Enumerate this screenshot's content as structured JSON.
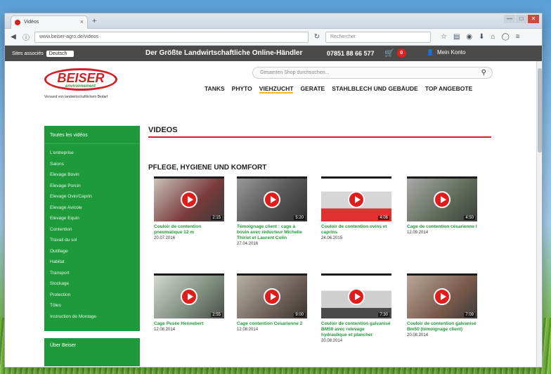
{
  "browser": {
    "tab_title": "Vidéos",
    "url": "www.beiser-agro.de/videos",
    "search_placeholder": "Rechercher",
    "window_controls": [
      "—",
      "□",
      "✕"
    ]
  },
  "topbar": {
    "lang_label": "Sites associés",
    "lang_value": "Deutsch",
    "tagline": "Der Größte Landwirtschaftliche Online-Händler",
    "phone": "07851 88 66 577",
    "cart_count": "0",
    "account_label": "Mein Konto"
  },
  "header": {
    "logo_main": "BEISER",
    "logo_sub": "environnement",
    "logo_tagline": "Versand von landwirtschaftlichem Bedarf",
    "search_placeholder": "Gesamten Shop durchsuchen...",
    "nav": [
      "TANKS",
      "PHYTO",
      "VIEHZUCHT",
      "GERATE",
      "STAHLBLECH UND GEBÄUDE",
      "TOP ANGEBOTE"
    ],
    "nav_active": "VIEHZUCHT"
  },
  "sidebar": {
    "head": "Toutes les vidéos",
    "items": [
      "L'entreprise",
      "Salons",
      "Elevage Bovin",
      "Elevage Porcin",
      "Elevage Ovin/Caprin",
      "Elevage Avicole",
      "Elevage Equin",
      "Contention",
      "Travail du sol",
      "Outillage",
      "Habitat",
      "Transport",
      "Stockage",
      "Protection",
      "Tôles",
      "Instruction de Montage"
    ],
    "footer": "Über Beiser"
  },
  "main": {
    "title": "VIDEOS",
    "section": "PFLEGE, HYGIENE UND KOMFORT",
    "videos": [
      {
        "title": "Couloir de contention pneumatique 12 m",
        "date": "20.07.2016",
        "duration": "2:15"
      },
      {
        "title": "Témoignage client : cage à bovin avec réducteur Michelle Thiriet et Laurent Colin",
        "date": "27.04.2016",
        "duration": "5:20"
      },
      {
        "title": "Couloir de contention ovins et caprins",
        "date": "24.06.2015",
        "duration": "4:06"
      },
      {
        "title": "Cage de contention césarienne I",
        "date": "12.09.2014",
        "duration": "4:50"
      },
      {
        "title": "Cage Pesée Hennebert",
        "date": "12.08.2014",
        "duration": "2:55"
      },
      {
        "title": "Cage contention Cesarienne 2",
        "date": "12.08.2014",
        "duration": "9:00"
      },
      {
        "title": "Couloir de contention galvanisé BM50 avec relevage hydraulique et plancher",
        "date": "20.08.2014",
        "duration": "7:30"
      },
      {
        "title": "Couloir de contention galvanisé Bm50 (témoignage client)",
        "date": "20.08.2014",
        "duration": "7:09"
      }
    ]
  },
  "colors": {
    "brand_red": "#d41f26",
    "brand_green": "#1e9a3a",
    "accent_yellow": "#f2b81c"
  }
}
